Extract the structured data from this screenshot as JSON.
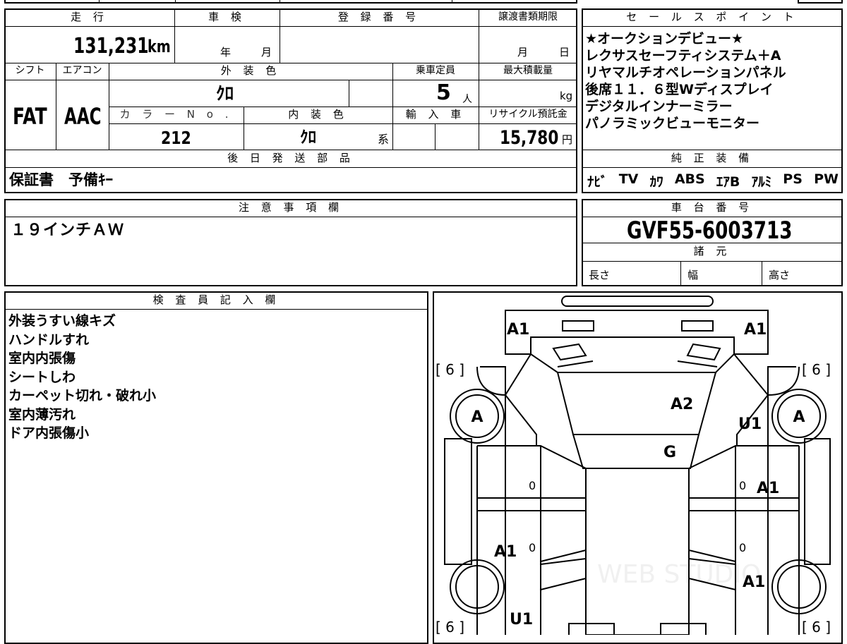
{
  "sheet": {
    "top_box": {
      "mileage_label": "走 行",
      "mileage_value": "131,231",
      "mileage_unit": "km",
      "inspection_label": "車 検",
      "inspection_year_unit": "年",
      "inspection_month_unit": "月",
      "registration_label": "登 録 番 号",
      "transfer_deadline_label": "譲渡書類期限",
      "transfer_month_unit": "月",
      "transfer_day_unit": "日",
      "shift_label": "シフト",
      "shift_value": "FAT",
      "ac_label": "エアコン",
      "ac_value": "AAC",
      "exterior_color_label": "外 装 色",
      "exterior_color_value": "ｸﾛ",
      "capacity_label": "乗車定員",
      "capacity_value": "5",
      "capacity_unit": "人",
      "max_load_label": "最大積載量",
      "max_load_unit": "kg",
      "color_no_label": "カ ラ ー N o .",
      "color_no_value": "212",
      "interior_color_label": "内 装 色",
      "interior_color_value": "ｸﾛ",
      "interior_color_suffix": "系",
      "import_label": "輸 入 車",
      "recycle_label": "リサイクル預託金",
      "recycle_value": "15,780",
      "recycle_unit": "円",
      "later_parts_label": "後 日 発 送 部 品",
      "later_parts_value": "保証書　予備ｷｰ"
    },
    "sales_points": {
      "label": "セ ー ル ス ポ イ ン ト",
      "lines": [
        "★オークションデビュー★",
        "レクサスセーフティシステム＋A",
        "リヤマルチオペレーションパネル",
        "後席１１．６型Wディスプレイ",
        "デジタルインナーミラー",
        "パノラミックビューモニター"
      ],
      "equipment_label": "純 正 装 備",
      "equipment_items": [
        "ﾅﾋﾞ",
        "TV",
        "ｶﾜ",
        "ABS",
        "ｴｱB",
        "ｱﾙﾐ",
        "PS",
        "PW"
      ]
    },
    "notes": {
      "label": "注 意 事 項 欄",
      "text": "１９インチＡＷ"
    },
    "chassis": {
      "label": "車 台 番 号",
      "value": "GVF55-6003713",
      "specs_label": "諸 元",
      "length_label": "長さ",
      "width_label": "幅",
      "height_label": "高さ"
    },
    "inspector": {
      "label": "検 査 員 記 入 欄",
      "lines": [
        "外装うすい線キズ",
        "ハンドルすれ",
        "室内内張傷",
        "シートしわ",
        "カーペット切れ・破れ小",
        "室内薄汚れ",
        "ドア内張傷小"
      ]
    },
    "diagram": {
      "marks": {
        "front_left": "A1",
        "front_right": "A1",
        "tire_fl": "[ 6 ]",
        "tire_fr": "[ 6 ]",
        "tire_rl": "[ 6 ]",
        "tire_rr": "[ 6 ]",
        "wheel_fl": "A",
        "wheel_fr": "A",
        "hood": "A2",
        "fender_fr": "U1",
        "windshield": "G",
        "front_door_r": "A1",
        "rear_door_l": "A1",
        "rear_quarter_r": "A1",
        "rear_quarter_l": "U1",
        "door_num_fl": "0",
        "door_num_fr": "0",
        "door_num_rl": "0",
        "door_num_rr": "0"
      },
      "watermark": "WEB STUDIO"
    }
  }
}
